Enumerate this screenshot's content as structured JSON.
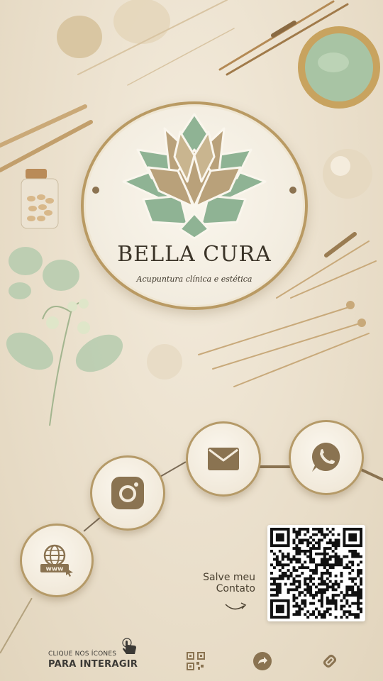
{
  "brand": {
    "name": "BELLA CURA",
    "tagline": "Acupuntura clínica e estética"
  },
  "actions": [
    {
      "id": "website",
      "icon": "globe-www-icon"
    },
    {
      "id": "instagram",
      "icon": "instagram-icon"
    },
    {
      "id": "email",
      "icon": "envelope-icon"
    },
    {
      "id": "whatsapp",
      "icon": "whatsapp-icon"
    }
  ],
  "contact": {
    "save_line1": "Salve meu",
    "save_line2": "Contato",
    "qr_icon": "qr-code"
  },
  "footer": {
    "hint_line1": "CLIQUE NOS ÍCONES",
    "hint_line2": "PARA INTERAGIR",
    "buttons": [
      {
        "id": "qr",
        "icon": "qr-code-icon"
      },
      {
        "id": "share",
        "icon": "share-arrow-icon"
      },
      {
        "id": "link",
        "icon": "link-icon"
      }
    ]
  },
  "colors": {
    "background": "#eadfcb",
    "sage": "#8fb394",
    "tan": "#b9a17a",
    "gold": "#b59a68",
    "brown": "#8a7351",
    "text": "#3b3428"
  }
}
